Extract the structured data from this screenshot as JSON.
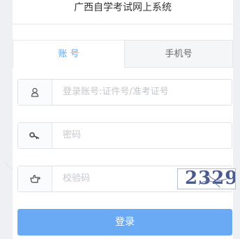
{
  "title": "广西自学考试网上系统",
  "tabs": [
    {
      "label": "账 号",
      "active": true
    },
    {
      "label": "手机号",
      "active": false
    }
  ],
  "fields": {
    "account": {
      "placeholder": "登录账号:证件号/准考证号",
      "icon": "user-icon"
    },
    "password": {
      "placeholder": "密码",
      "icon": "key-icon"
    },
    "captcha": {
      "placeholder": "校验码",
      "icon": "hand-point-icon",
      "image_text": "2329"
    }
  },
  "login_button": "登录",
  "colors": {
    "accent": "#6aa9f4",
    "tab_active": "#6aa8f2"
  }
}
